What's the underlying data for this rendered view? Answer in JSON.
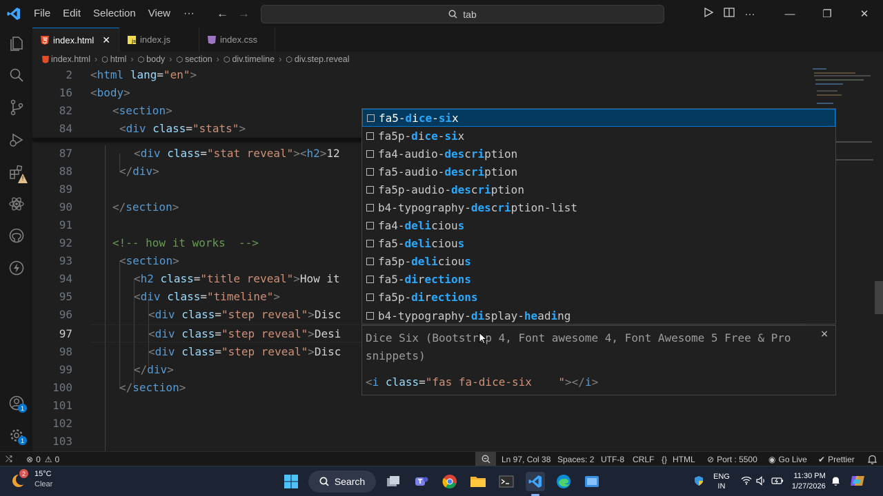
{
  "titlebar": {
    "menu": [
      "File",
      "Edit",
      "Selection",
      "View"
    ],
    "more": "···",
    "search_text": "tab"
  },
  "tabs": [
    {
      "label": "index.html",
      "icon": "html-file-icon",
      "active": true
    },
    {
      "label": "index.js",
      "icon": "js-file-icon",
      "active": false
    },
    {
      "label": "index.css",
      "icon": "css-file-icon",
      "active": false
    }
  ],
  "breadcrumb": [
    "index.html",
    "html",
    "body",
    "section",
    "div.timeline",
    "div.step.reveal"
  ],
  "editor": {
    "line_numbers": [
      "2",
      "16",
      "82",
      "84",
      "87",
      "88",
      "89",
      "90",
      "91",
      "92",
      "93",
      "94",
      "95",
      "96",
      "97",
      "98",
      "99",
      "100",
      "101",
      "102",
      "103"
    ],
    "current_line": "97"
  },
  "code": {
    "l2": {
      "lt": "<",
      "tag": "html",
      "attr": "lang",
      "eq": "=",
      "val": "\"en\"",
      "gt": ">"
    },
    "l16": {
      "lt": "<",
      "tag": "body",
      "gt": ">"
    },
    "l82": {
      "lt": "<",
      "tag": "section",
      "gt": ">"
    },
    "l84": {
      "lt": "<",
      "tag": "div",
      "attr": "class",
      "eq": "=",
      "val": "\"stats\"",
      "gt": ">"
    },
    "l87": {
      "lt": "<",
      "tag": "div",
      "attr": "class",
      "eq": "=",
      "val": "\"stat reveal\"",
      "gt": ">",
      "lt2": "<",
      "tag2": "h2",
      "gt2": ">",
      "text": "12"
    },
    "l88": {
      "lt": "</",
      "tag": "div",
      "gt": ">"
    },
    "l90": {
      "lt": "</",
      "tag": "section",
      "gt": ">"
    },
    "l92": {
      "comment": "<!-- how it works  -->"
    },
    "l93": {
      "lt": "<",
      "tag": "section",
      "gt": ">"
    },
    "l94": {
      "lt": "<",
      "tag": "h2",
      "attr": "class",
      "eq": "=",
      "val": "\"title reveal\"",
      "gt": ">",
      "text": "How it"
    },
    "l95": {
      "lt": "<",
      "tag": "div",
      "attr": "class",
      "eq": "=",
      "val": "\"timeline\"",
      "gt": ">"
    },
    "l96": {
      "lt": "<",
      "tag": "div",
      "attr": "class",
      "eq": "=",
      "val": "\"step reveal\"",
      "gt": ">",
      "text": "Disc"
    },
    "l97": {
      "lt": "<",
      "tag": "div",
      "attr": "class",
      "eq": "=",
      "val": "\"step reveal\"",
      "gt": ">",
      "text": "Desi"
    },
    "l98": {
      "lt": "<",
      "tag": "div",
      "attr": "class",
      "eq": "=",
      "val": "\"step reveal\"",
      "gt": ">",
      "text": "Disc"
    },
    "l99": {
      "lt": "</",
      "tag": "div",
      "gt": ">"
    },
    "l100": {
      "lt": "</",
      "tag": "section",
      "gt": ">"
    }
  },
  "suggestions": [
    [
      {
        "t": "fa5-"
      },
      {
        "t": "d",
        "h": 1
      },
      {
        "t": "i"
      },
      {
        "t": "c",
        "h": 1
      },
      {
        "t": "e",
        "h": 1
      },
      {
        "t": "-"
      },
      {
        "t": "s",
        "h": 1
      },
      {
        "t": "i",
        "h": 1
      },
      {
        "t": "x"
      }
    ],
    [
      {
        "t": "fa5p-"
      },
      {
        "t": "d",
        "h": 1
      },
      {
        "t": "i"
      },
      {
        "t": "c",
        "h": 1
      },
      {
        "t": "e",
        "h": 1
      },
      {
        "t": "-"
      },
      {
        "t": "s",
        "h": 1
      },
      {
        "t": "i",
        "h": 1
      },
      {
        "t": "x"
      }
    ],
    [
      {
        "t": "fa4-audio-"
      },
      {
        "t": "des",
        "h": 1
      },
      {
        "t": "c"
      },
      {
        "t": "ri",
        "h": 1
      },
      {
        "t": "ption"
      }
    ],
    [
      {
        "t": "fa5-audio-"
      },
      {
        "t": "des",
        "h": 1
      },
      {
        "t": "c"
      },
      {
        "t": "ri",
        "h": 1
      },
      {
        "t": "ption"
      }
    ],
    [
      {
        "t": "fa5p-audio-"
      },
      {
        "t": "des",
        "h": 1
      },
      {
        "t": "c"
      },
      {
        "t": "ri",
        "h": 1
      },
      {
        "t": "ption"
      }
    ],
    [
      {
        "t": "b4-typography-"
      },
      {
        "t": "des",
        "h": 1
      },
      {
        "t": "c"
      },
      {
        "t": "ri",
        "h": 1
      },
      {
        "t": "ption-list"
      }
    ],
    [
      {
        "t": "fa4-"
      },
      {
        "t": "deli",
        "h": 1
      },
      {
        "t": "ciou"
      },
      {
        "t": "s",
        "h": 1
      }
    ],
    [
      {
        "t": "fa5-"
      },
      {
        "t": "deli",
        "h": 1
      },
      {
        "t": "ciou"
      },
      {
        "t": "s",
        "h": 1
      }
    ],
    [
      {
        "t": "fa5p-"
      },
      {
        "t": "deli",
        "h": 1
      },
      {
        "t": "ciou"
      },
      {
        "t": "s",
        "h": 1
      }
    ],
    [
      {
        "t": "fa5-"
      },
      {
        "t": "di",
        "h": 1
      },
      {
        "t": "r"
      },
      {
        "t": "e",
        "h": 1
      },
      {
        "t": "ctions",
        "h": 1
      }
    ],
    [
      {
        "t": "fa5p-"
      },
      {
        "t": "di",
        "h": 1
      },
      {
        "t": "r"
      },
      {
        "t": "e",
        "h": 1
      },
      {
        "t": "ctions",
        "h": 1
      }
    ],
    [
      {
        "t": "b4-typography-"
      },
      {
        "t": "di",
        "h": 1
      },
      {
        "t": "splay-"
      },
      {
        "t": "he",
        "h": 1
      },
      {
        "t": "ad"
      },
      {
        "t": "i",
        "h": 1
      },
      {
        "t": "ng"
      }
    ]
  ],
  "details": {
    "description": "Dice Six (Bootstrap 4, Font awesome 4, Font Awesome 5 Free & Pro snippets)",
    "code_lt": "<",
    "code_tag": "i",
    "code_attr": "class",
    "code_eq": "=",
    "code_val": "\"fas fa-dice-six    \"",
    "code_end": "></",
    "code_tag2": "i",
    "code_gt": ">",
    "close": "×"
  },
  "statusbar": {
    "errors": "0",
    "warnings": "0",
    "position": "Ln 97, Col 38",
    "spaces": "Spaces: 2",
    "encoding": "UTF-8",
    "eol": "CRLF",
    "language": "HTML",
    "port": "Port : 5500",
    "golive": "Go Live",
    "prettier": "Prettier"
  },
  "taskbar": {
    "weather_badge": "2",
    "temperature": "15°C",
    "condition": "Clear",
    "search": "Search",
    "lang_top": "ENG",
    "lang_bottom": "IN",
    "time": "11:30 PM",
    "date": "1/27/2026"
  },
  "colors": {
    "accent": "#0078d4",
    "suggest_highlight": "#2aaaff"
  }
}
